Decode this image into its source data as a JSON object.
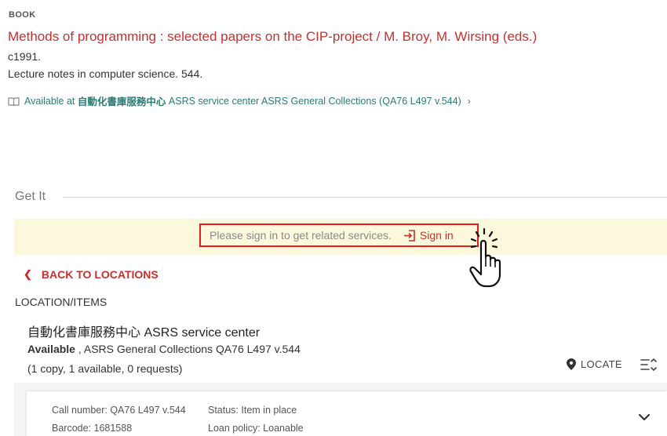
{
  "record": {
    "type": "BOOK",
    "title": "Methods of programming : selected papers on the CIP-project / M. Broy, M. Wirsing (eds.)",
    "date": "c1991.",
    "series": "Lecture notes in computer science. 544.",
    "availability": {
      "prefix": "Available at",
      "library": "自動化書庫服務中心",
      "text": "ASRS service center  ASRS General Collections (QA76 L497 v.544)",
      "icon": "book-icon"
    }
  },
  "getit": {
    "title": "Get It",
    "signin_message": "Please sign in to get related services.",
    "signin_label": "Sign in",
    "back_label": "BACK TO LOCATIONS",
    "location_items_label": "LOCATION/ITEMS"
  },
  "location": {
    "name": "自動化書庫服務中心 ASRS service center",
    "status_bold": "Available",
    "status_rest": " , ASRS General Collections QA76 L497 v.544",
    "counts": "(1 copy, 1 available, 0 requests)",
    "locate_label": "LOCATE"
  },
  "item": {
    "call_number": "Call number: QA76 L497 v.544",
    "barcode": "Barcode: 1681588",
    "status": "Status: Item in place",
    "loan_policy": "Loan policy: Loanable"
  },
  "colors": {
    "title_red": "#c8302e",
    "availability_teal": "#2a7a73",
    "banner_yellow": "#fbf8dc",
    "highlight_red": "#e01e1e"
  }
}
